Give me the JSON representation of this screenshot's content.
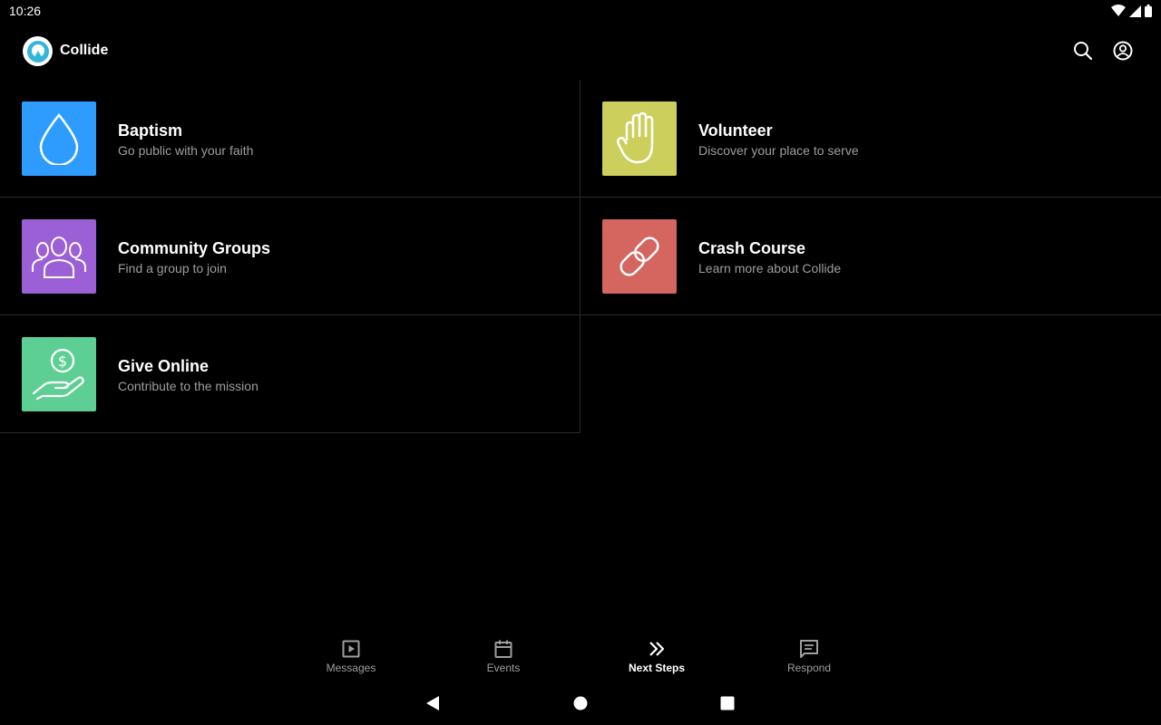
{
  "status_bar": {
    "time": "10:26"
  },
  "app_bar": {
    "title": "Collide",
    "logo_icon": "collide-logo",
    "actions": [
      "search-icon",
      "account-icon"
    ]
  },
  "cards": [
    {
      "title": "Baptism",
      "subtitle": "Go public with your faith",
      "color": "#2e9cff",
      "icon": "water-drop-icon"
    },
    {
      "title": "Volunteer",
      "subtitle": "Discover your place to serve",
      "color": "#cdcf5c",
      "icon": "hand-icon"
    },
    {
      "title": "Community Groups",
      "subtitle": "Find a group to join",
      "color": "#9b5fd6",
      "icon": "group-icon"
    },
    {
      "title": "Crash Course",
      "subtitle": "Learn more about Collide",
      "color": "#d4655f",
      "icon": "link-icon"
    },
    {
      "title": "Give Online",
      "subtitle": "Contribute to the mission",
      "color": "#5ecf94",
      "icon": "give-money-icon"
    }
  ],
  "bottom_nav": {
    "items": [
      {
        "label": "Messages",
        "icon": "play-icon",
        "active": false
      },
      {
        "label": "Events",
        "icon": "calendar-icon",
        "active": false
      },
      {
        "label": "Next Steps",
        "icon": "double-chevron-icon",
        "active": true
      },
      {
        "label": "Respond",
        "icon": "message-icon",
        "active": false
      }
    ]
  },
  "colors": {
    "background": "#000000",
    "divider": "#2a2a2a",
    "muted_text": "#9e9e9e",
    "accent": "#ffffff"
  }
}
